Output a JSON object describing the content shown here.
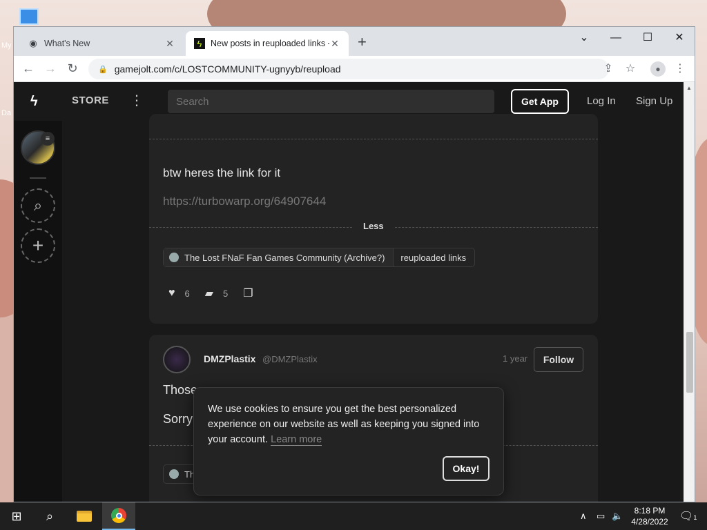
{
  "browser": {
    "tabs": [
      {
        "title": "What's New",
        "active": false
      },
      {
        "title": "New posts in reuploaded links -",
        "active": true
      }
    ],
    "url": "gamejolt.com/c/LOSTCOMMUNITY-ugnyyb/reupload"
  },
  "header": {
    "store": "STORE",
    "search_placeholder": "Search",
    "get_app": "Get App",
    "log_in": "Log In",
    "sign_up": "Sign Up"
  },
  "post1": {
    "text": "btw heres the link for it",
    "link": "https://turbowarp.org/64907644",
    "less": "Less",
    "community": "The Lost FNaF Fan Games Community (Archive?)",
    "channel": "reuploaded links",
    "likes": "6",
    "comments": "5"
  },
  "post2": {
    "name": "DMZPlastix",
    "handle": "@DMZPlastix",
    "time": "1 year",
    "follow": "Follow",
    "line1_start": "Those",
    "line2_start": "Sorry",
    "chip_start": "Th"
  },
  "cookie": {
    "text": "We use cookies to ensure you get the best personalized experience on our website as well as keeping you signed into your account.",
    "learn_more": "Learn more",
    "ok": "Okay!"
  },
  "taskbar": {
    "time": "8:18 PM",
    "date": "4/28/2022",
    "notifications": "1"
  },
  "desktop": {
    "icon_label_1": "My",
    "icon_label_2": "Da"
  }
}
